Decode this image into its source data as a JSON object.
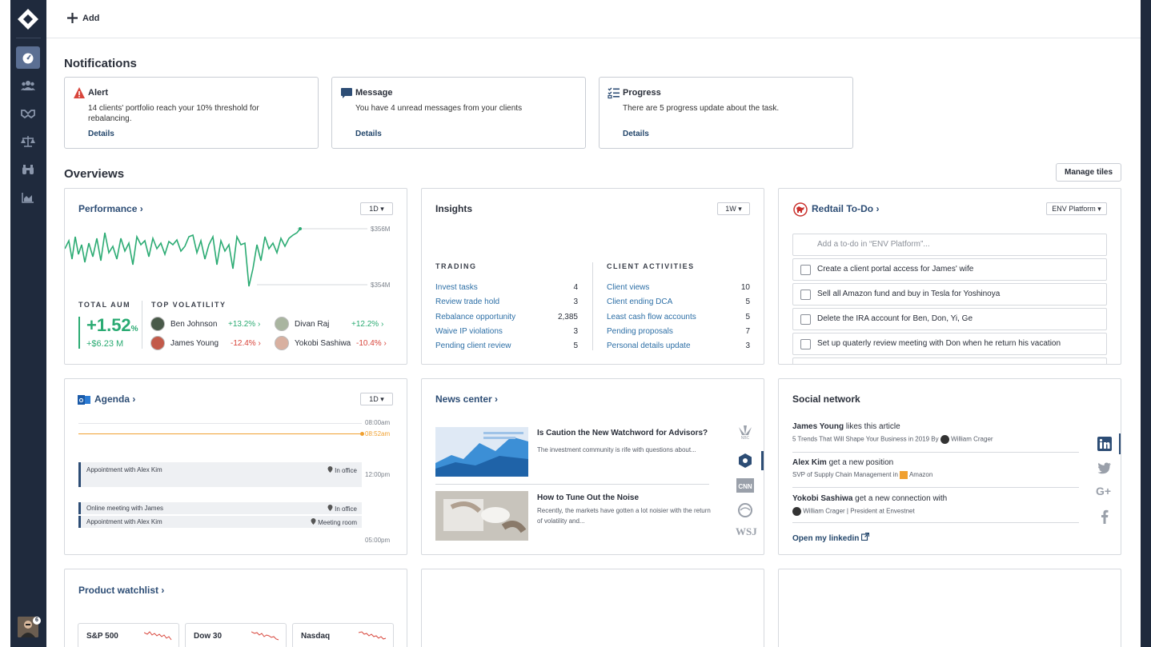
{
  "topbar": {
    "add_label": "Add"
  },
  "notifications": {
    "title": "Notifications",
    "alert": {
      "title": "Alert",
      "body": "14 clients' portfolio reach your 10% threshold for rebalancing.",
      "link": "Details"
    },
    "message": {
      "title": "Message",
      "body": "You have 4 unread messages from your clients",
      "link": "Details"
    },
    "progress": {
      "title": "Progress",
      "body": "There are 5 progress update about the task.",
      "link": "Details"
    }
  },
  "overviews": {
    "title": "Overviews",
    "manage_label": "Manage tiles"
  },
  "performance": {
    "title": "Performance",
    "range": "1D",
    "y_top": "$356M",
    "y_bottom": "$354M",
    "total_aum_label": "TOTAL AUM",
    "aum_pct": "+1.52",
    "aum_pct_unit": "%",
    "aum_value": "+$6.23 M",
    "volatility_label": "TOP VOLATILITY",
    "volatility": [
      {
        "name": "Ben Johnson",
        "change": "+13.2%"
      },
      {
        "name": "Divan Raj",
        "change": "+12.2%"
      },
      {
        "name": "James Young",
        "change": "-12.4%"
      },
      {
        "name": "Yokobi Sashiwa",
        "change": "-10.4%"
      }
    ]
  },
  "insights": {
    "title": "Insights",
    "range": "1W",
    "trading_label": "TRADING",
    "client_label": "CLIENT ACTIVITIES",
    "trading": [
      {
        "label": "Invest tasks",
        "value": "4"
      },
      {
        "label": "Review trade hold",
        "value": "3"
      },
      {
        "label": "Rebalance opportunity",
        "value": "2,385"
      },
      {
        "label": "Waive IP violations",
        "value": "3"
      },
      {
        "label": "Pending client review",
        "value": "5"
      }
    ],
    "client": [
      {
        "label": "Client views",
        "value": "10"
      },
      {
        "label": "Client ending DCA",
        "value": "5"
      },
      {
        "label": "Least cash flow accounts",
        "value": "5"
      },
      {
        "label": "Pending proposals",
        "value": "7"
      },
      {
        "label": "Personal details update",
        "value": "3"
      }
    ]
  },
  "redtail": {
    "title": "Redtail To-Do",
    "platform": "ENV Platform",
    "input_placeholder": "Add a to-do in “ENV Platform”...",
    "items": [
      "Create a client portal access for James' wife",
      "Sell all Amazon fund and buy in Tesla for Yoshinoya",
      "Delete the IRA account for Ben, Don, Yi, Ge",
      "Set up quaterly review meeting with Don when he return his vacation"
    ]
  },
  "agenda": {
    "title": "Agenda",
    "range": "1D",
    "time_1": "08:00am",
    "time_now": "08:52am",
    "time_2": "12:00pm",
    "time_3": "05:00pm",
    "appointments": [
      {
        "title": "Appointment with Alex Kim",
        "location": "In office"
      },
      {
        "title": "Online meeting with James",
        "location": "In office"
      },
      {
        "title": "Appointment with Alex Kim",
        "location": "Meeting room"
      }
    ]
  },
  "news": {
    "title": "News center",
    "items": [
      {
        "title": "Is Caution the New Watchword for Advisors?",
        "desc": "The investment community is rife with questions about..."
      },
      {
        "title": "How to Tune Out the Noise",
        "desc": "Recently, the markets have gotten a lot noisier with the return of volatility and..."
      }
    ],
    "sources": [
      "NBC",
      "Reuters",
      "CNN",
      "WSJ"
    ]
  },
  "social": {
    "title": "Social network",
    "items": [
      {
        "name": "James Young",
        "action": " likes this article",
        "sub": "5 Trends That Will Shape Your Business in 2019 By",
        "sub2": "William Crager"
      },
      {
        "name": "Alex Kim",
        "action": " get a new position",
        "sub": "SVP of Supply Chain Management in",
        "sub2": "Amazon"
      },
      {
        "name": "Yokobi Sashiwa",
        "action": " get a new connection with",
        "sub": "",
        "sub2": "William Crager | President at Envestnet"
      }
    ],
    "link": "Open my linkedin"
  },
  "watchlist": {
    "title": "Product watchlist",
    "tickers": [
      "S&P 500",
      "Dow 30",
      "Nasdaq"
    ]
  },
  "colors": {
    "accent": "#2d4d75",
    "green": "#2bab73",
    "red": "#d8453b",
    "sidebar": "#1f2a3d"
  }
}
